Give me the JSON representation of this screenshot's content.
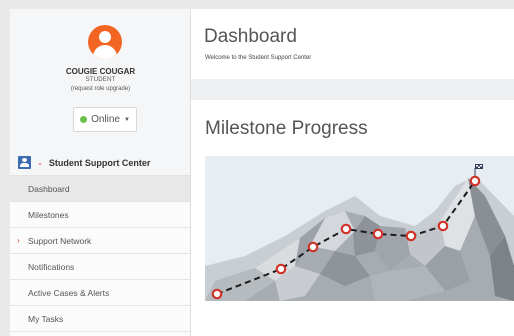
{
  "user": {
    "name": "COUGIE COUGAR",
    "role": "STUDENT",
    "role_upgrade": "(request role upgrade)",
    "status": "Online",
    "status_color": "#6cc04a"
  },
  "sidebar": {
    "section_title": "Student Support Center",
    "items": [
      {
        "label": "Dashboard"
      },
      {
        "label": "Milestones"
      },
      {
        "label": "Support Network"
      },
      {
        "label": "Notifications"
      },
      {
        "label": "Active Cases & Alerts"
      },
      {
        "label": "My Tasks"
      }
    ]
  },
  "header": {
    "title": "Dashboard",
    "subtitle": "Welcome to the Student Support Center"
  },
  "milestones": {
    "title": "Milestone Progress",
    "total": 9,
    "accent": "#d0332a"
  }
}
